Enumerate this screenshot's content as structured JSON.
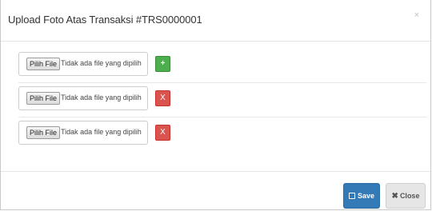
{
  "modal": {
    "title": "Upload Foto Atas Transaksi #TRS0000001",
    "close_glyph": "×"
  },
  "file_rows": [
    {
      "button_label": "Pilih File",
      "status_text": "Tidak ada file yang dipilih",
      "action_label": "+",
      "action_type": "add",
      "action_color": "#4cae4c"
    },
    {
      "button_label": "Pilih File",
      "status_text": "Tidak ada file yang dipilih",
      "action_label": "X",
      "action_type": "remove",
      "action_color": "#d9534f"
    },
    {
      "button_label": "Pilih File",
      "status_text": "Tidak ada file yang dipilih",
      "action_label": "X",
      "action_type": "remove",
      "action_color": "#d9534f"
    }
  ],
  "footer": {
    "save_label": "Save",
    "save_icon": "edit-icon",
    "save_color": "#337ab7",
    "close_label": "Close",
    "close_icon": "times-icon"
  }
}
